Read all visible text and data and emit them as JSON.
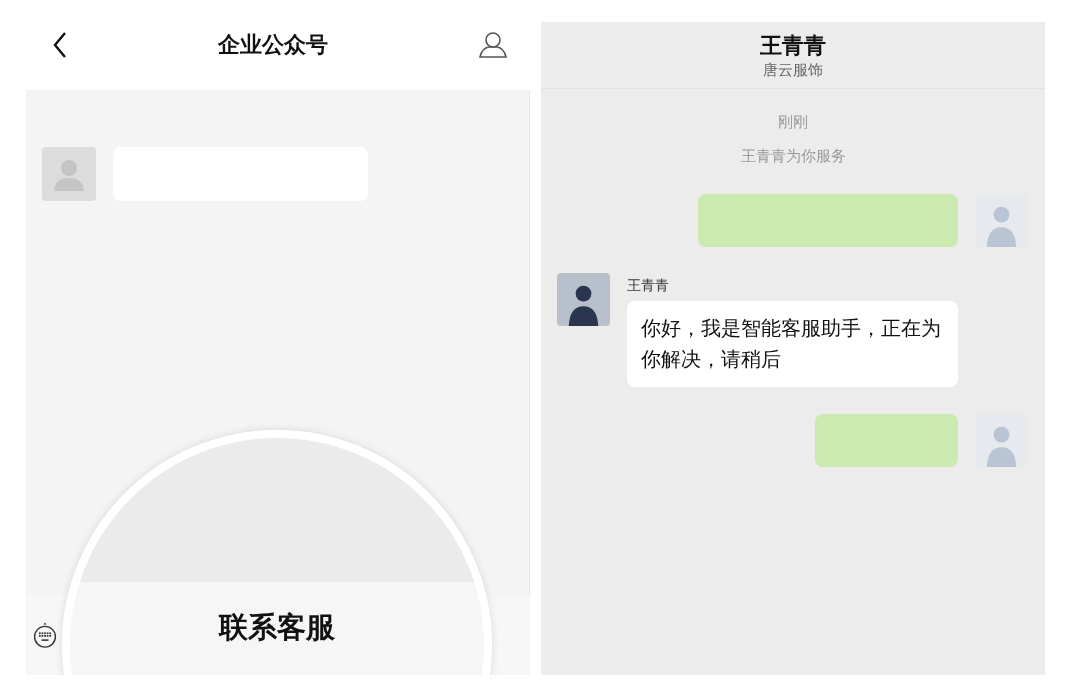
{
  "left_screen": {
    "title": "企业公众号",
    "messages": [
      {
        "kind": "incoming"
      }
    ],
    "magnified_button": {
      "label": "联系客服"
    }
  },
  "right_screen": {
    "contact_name": "王青青",
    "company": "唐云服饰",
    "timestamp": "刚刚",
    "system_note": "王青青为你服务",
    "messages": [
      {
        "kind": "outgoing"
      },
      {
        "kind": "incoming",
        "sender": "王青青",
        "text": "你好，我是智能客服助手，正在为你解决，请稍后"
      },
      {
        "kind": "outgoing"
      }
    ]
  }
}
